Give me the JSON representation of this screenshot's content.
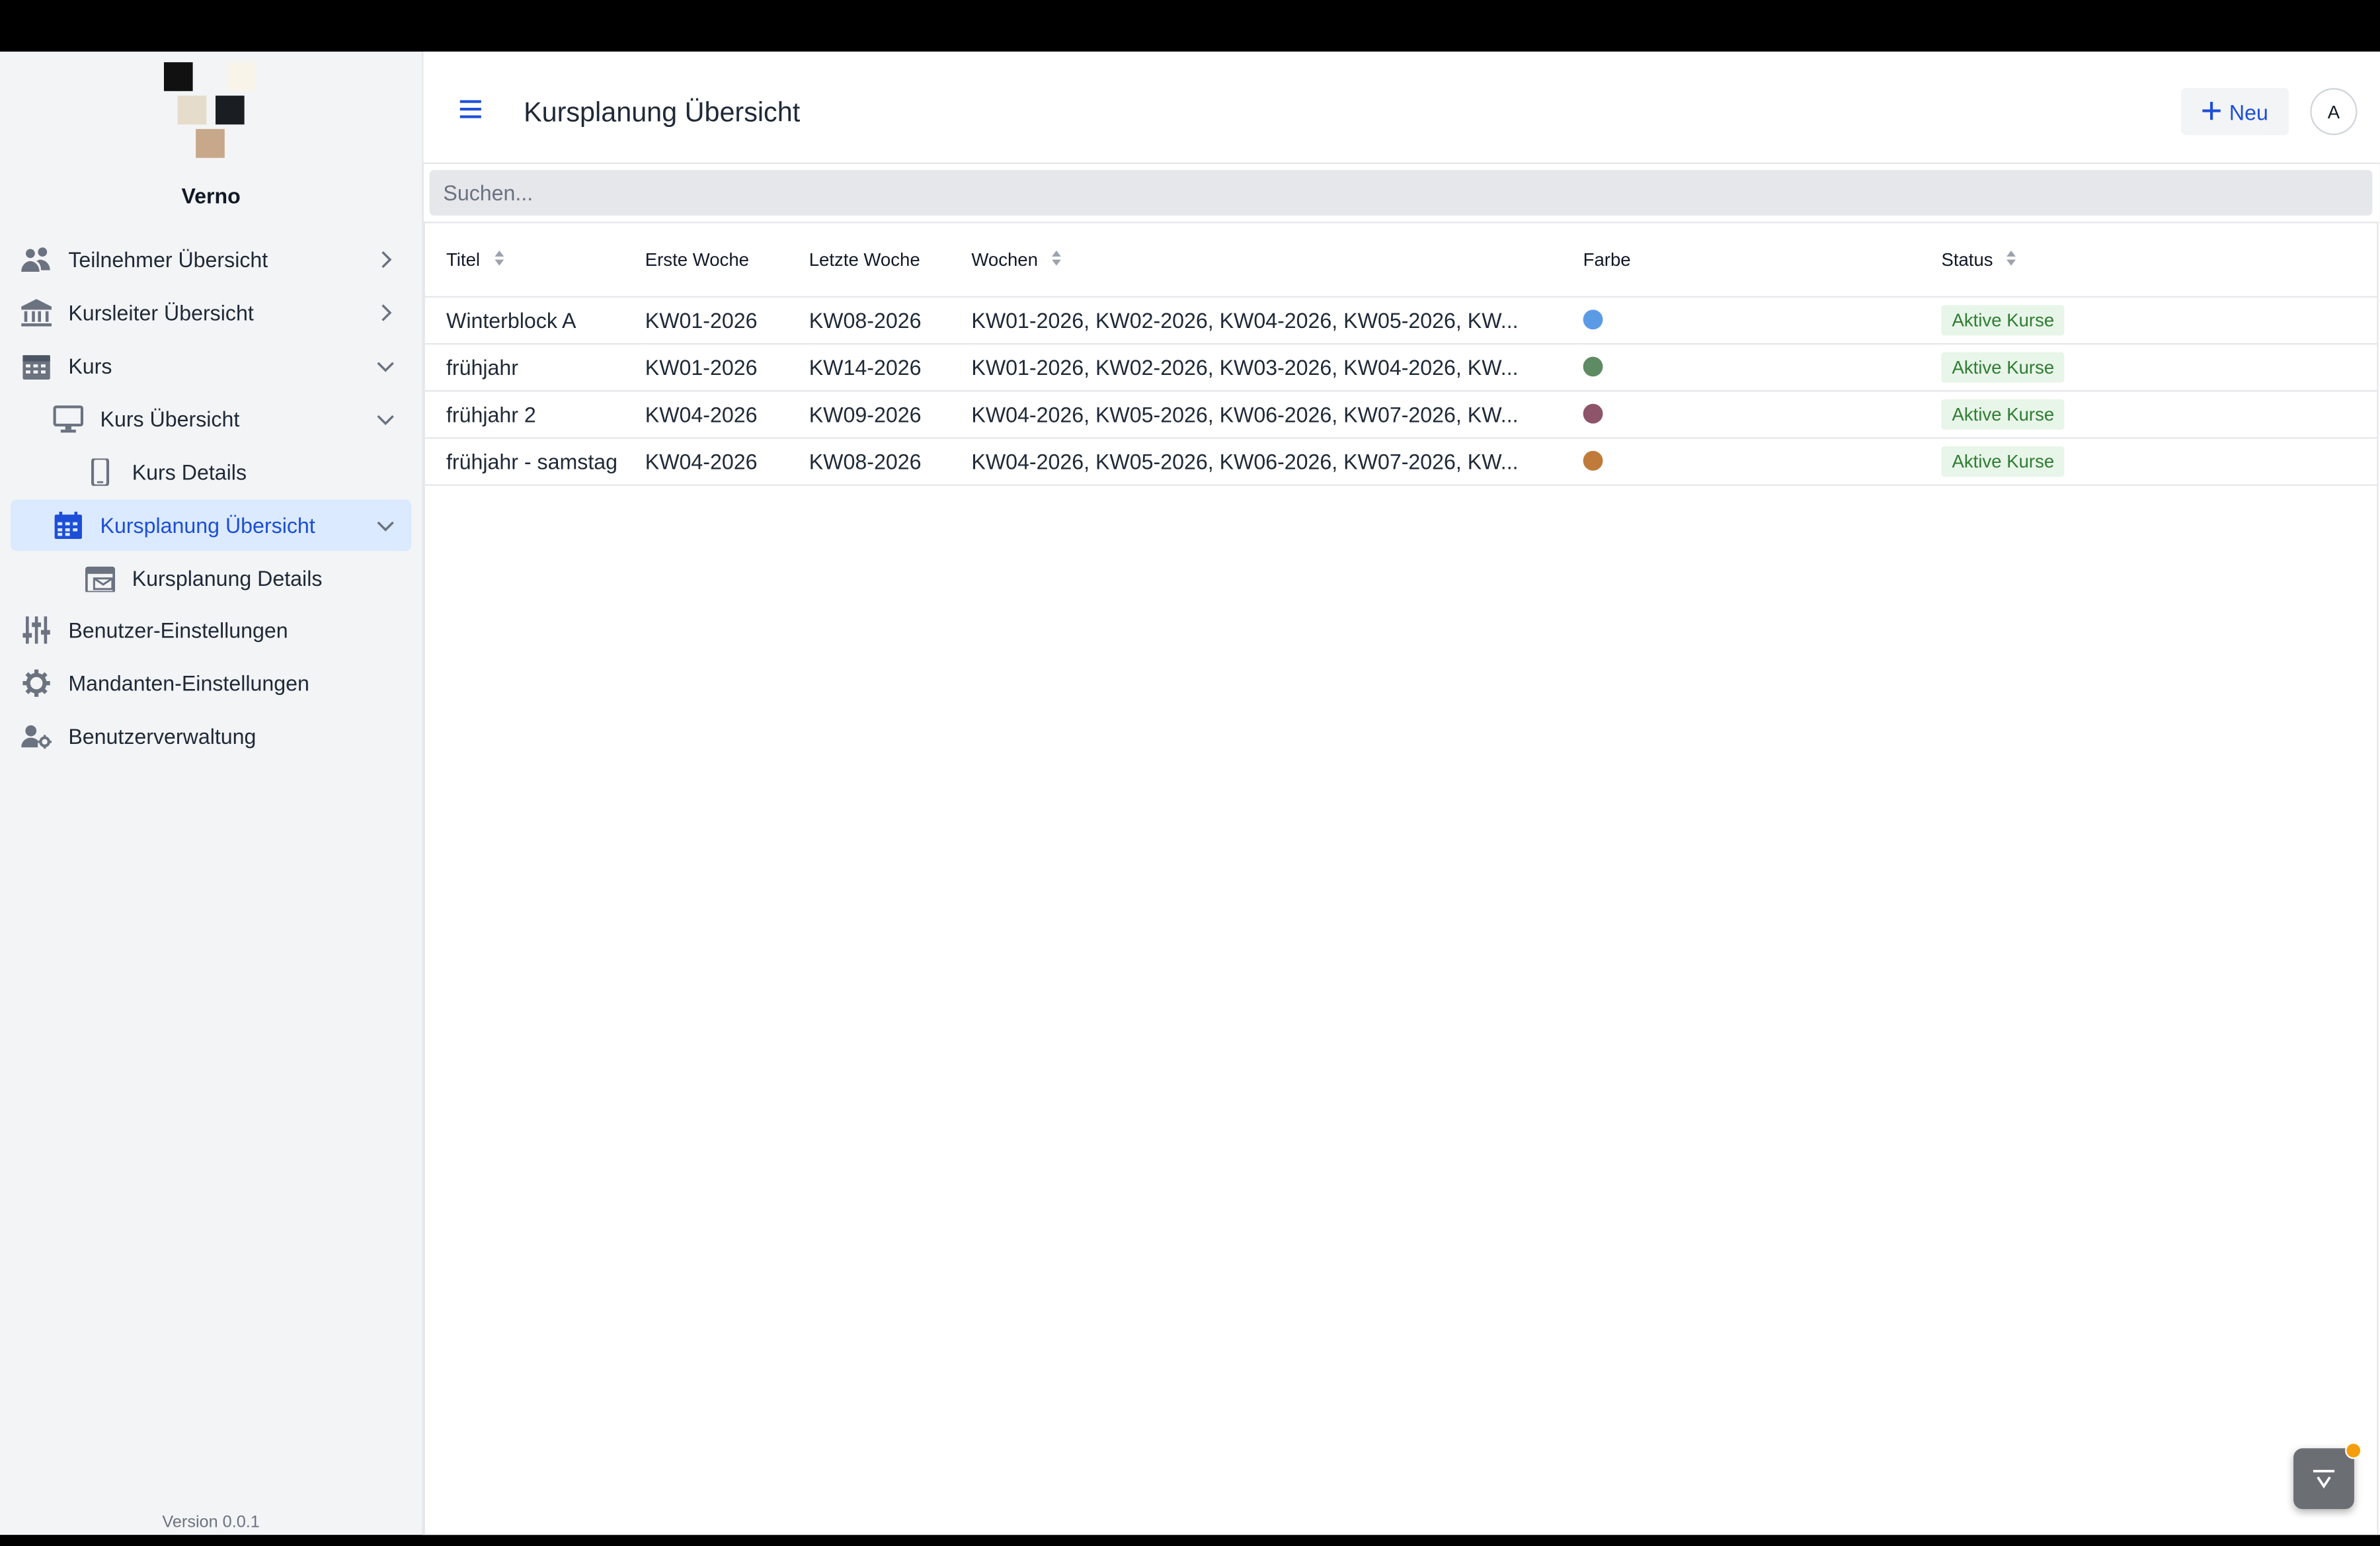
{
  "app": {
    "brand": "Verno",
    "version": "Version 0.0.1"
  },
  "colors": {
    "accent": "#1d4ed8",
    "active_bg": "#dbeafe",
    "badge_bg": "#e8f5e9",
    "badge_text": "#2e7d32"
  },
  "sidebar": {
    "items": [
      {
        "label": "Teilnehmer Übersicht",
        "icon": "users-icon",
        "chevron": "right"
      },
      {
        "label": "Kursleiter Übersicht",
        "icon": "bank-icon",
        "chevron": "right"
      },
      {
        "label": "Kurs",
        "icon": "calendar-icon",
        "chevron": "down"
      },
      {
        "label": "Kurs Übersicht",
        "icon": "monitor-icon",
        "chevron": "down"
      },
      {
        "label": "Kurs Details",
        "icon": "phone-icon",
        "chevron": ""
      },
      {
        "label": "Kursplanung Übersicht",
        "icon": "calendar-icon",
        "chevron": "down",
        "active": true
      },
      {
        "label": "Kursplanung Details",
        "icon": "calendar-envelope-icon",
        "chevron": ""
      },
      {
        "label": "Benutzer-Einstellungen",
        "icon": "sliders-icon",
        "chevron": ""
      },
      {
        "label": "Mandanten-Einstellungen",
        "icon": "gear-icon",
        "chevron": ""
      },
      {
        "label": "Benutzerverwaltung",
        "icon": "user-gear-icon",
        "chevron": ""
      }
    ]
  },
  "header": {
    "title": "Kursplanung Übersicht",
    "new_label": "Neu",
    "avatar_initial": "A"
  },
  "search": {
    "placeholder": "Suchen..."
  },
  "table": {
    "columns": [
      "Titel",
      "Erste Woche",
      "Letzte Woche",
      "Wochen",
      "Farbe",
      "Status"
    ],
    "rows": [
      {
        "titel": "Winterblock A",
        "erste": "KW01-2026",
        "letzte": "KW08-2026",
        "wochen": "KW01-2026, KW02-2026, KW04-2026, KW05-2026, KW...",
        "farbe": "#5b9be6",
        "status": "Aktive Kurse"
      },
      {
        "titel": "frühjahr",
        "erste": "KW01-2026",
        "letzte": "KW14-2026",
        "wochen": "KW01-2026, KW02-2026, KW03-2026, KW04-2026, KW...",
        "farbe": "#5e8a64",
        "status": "Aktive Kurse"
      },
      {
        "titel": "frühjahr 2",
        "erste": "KW04-2026",
        "letzte": "KW09-2026",
        "wochen": "KW04-2026, KW05-2026, KW06-2026, KW07-2026, KW...",
        "farbe": "#8e5469",
        "status": "Aktive Kurse"
      },
      {
        "titel": "frühjahr - samstag",
        "erste": "KW04-2026",
        "letzte": "KW08-2026",
        "wochen": "KW04-2026, KW05-2026, KW06-2026, KW07-2026, KW...",
        "farbe": "#c07a3a",
        "status": "Aktive Kurse"
      }
    ]
  }
}
